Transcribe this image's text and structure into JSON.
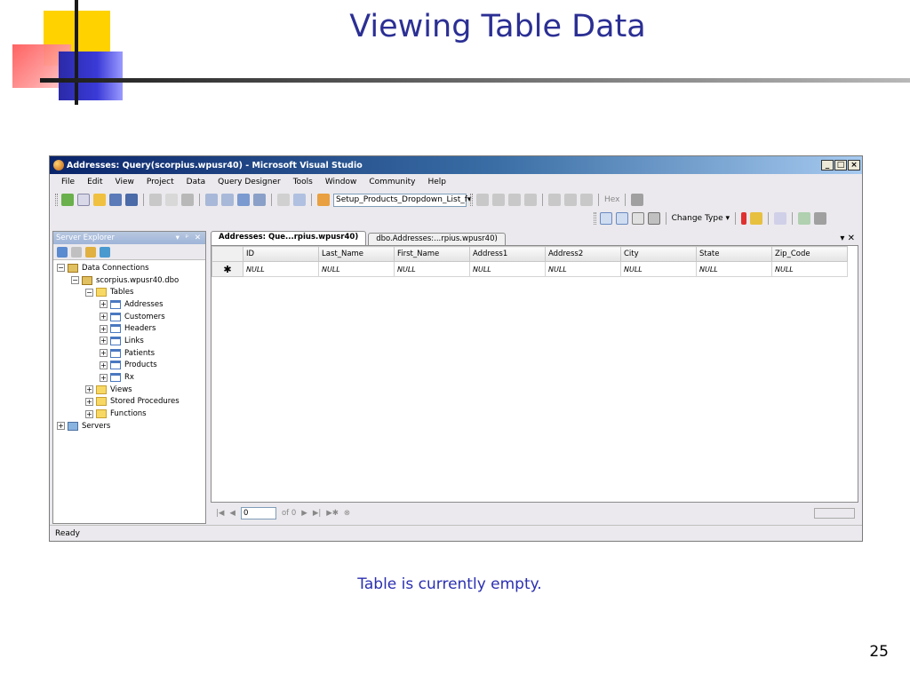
{
  "slide": {
    "title": "Viewing Table Data",
    "caption": "Table is currently empty.",
    "number": "25"
  },
  "window": {
    "title": "Addresses: Query(scorpius.wpusr40) - Microsoft Visual Studio",
    "min_glyph": "_",
    "max_glyph": "□",
    "close_glyph": "×"
  },
  "menu": [
    "File",
    "Edit",
    "View",
    "Project",
    "Data",
    "Query Designer",
    "Tools",
    "Window",
    "Community",
    "Help"
  ],
  "toolbar": {
    "combo_value": "Setup_Products_Dropdown_List_f",
    "hex_label": "Hex",
    "change_type_label": "Change Type ▾"
  },
  "server_explorer": {
    "title": "Server Explorer",
    "controls": "▾ ᵖ ✕",
    "tree": [
      {
        "label": "Data Connections",
        "indent": 0,
        "toggle": "−",
        "icon": "db"
      },
      {
        "label": "scorpius.wpusr40.dbo",
        "indent": 1,
        "toggle": "−",
        "icon": "db"
      },
      {
        "label": "Tables",
        "indent": 2,
        "toggle": "−",
        "icon": "folder"
      },
      {
        "label": "Addresses",
        "indent": 3,
        "toggle": "+",
        "icon": "table"
      },
      {
        "label": "Customers",
        "indent": 3,
        "toggle": "+",
        "icon": "table"
      },
      {
        "label": "Headers",
        "indent": 3,
        "toggle": "+",
        "icon": "table"
      },
      {
        "label": "Links",
        "indent": 3,
        "toggle": "+",
        "icon": "table"
      },
      {
        "label": "Patients",
        "indent": 3,
        "toggle": "+",
        "icon": "table"
      },
      {
        "label": "Products",
        "indent": 3,
        "toggle": "+",
        "icon": "table"
      },
      {
        "label": "Rx",
        "indent": 3,
        "toggle": "+",
        "icon": "table"
      },
      {
        "label": "Views",
        "indent": 2,
        "toggle": "+",
        "icon": "folder"
      },
      {
        "label": "Stored Procedures",
        "indent": 2,
        "toggle": "+",
        "icon": "folder"
      },
      {
        "label": "Functions",
        "indent": 2,
        "toggle": "+",
        "icon": "folder"
      },
      {
        "label": "Servers",
        "indent": 0,
        "toggle": "+",
        "icon": "server"
      }
    ]
  },
  "tabs": [
    {
      "label": "Addresses: Que...rpius.wpusr40)",
      "active": true
    },
    {
      "label": "dbo.Addresses:...rpius.wpusr40)",
      "active": false
    }
  ],
  "tab_controls": "▾ ✕",
  "grid": {
    "columns": [
      "ID",
      "Last_Name",
      "First_Name",
      "Address1",
      "Address2",
      "City",
      "State",
      "Zip_Code"
    ],
    "new_row_marker": "✱",
    "rows": [
      [
        "NULL",
        "NULL",
        "NULL",
        "NULL",
        "NULL",
        "NULL",
        "NULL",
        "NULL"
      ]
    ]
  },
  "nav": {
    "position": "0",
    "of_label": "of 0"
  },
  "status": "Ready"
}
